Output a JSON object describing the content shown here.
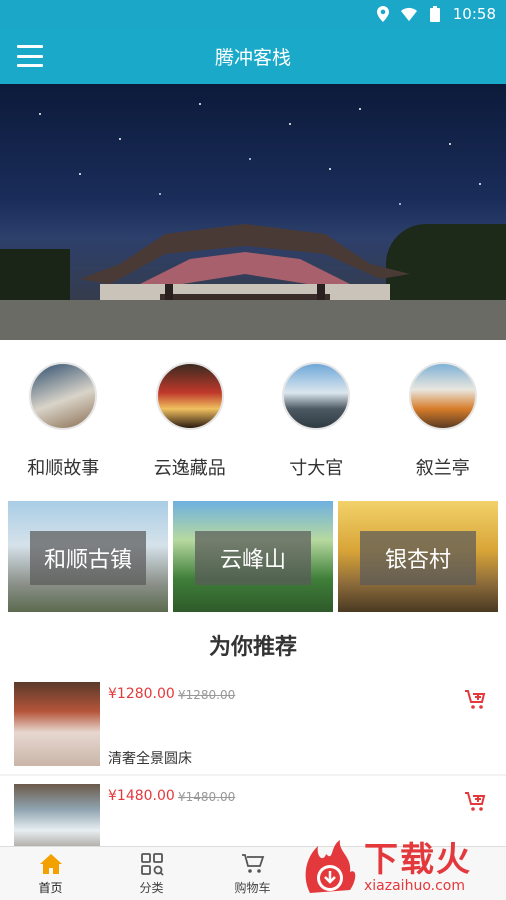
{
  "status_bar": {
    "time": "10:58"
  },
  "app_bar": {
    "title": "腾冲客栈"
  },
  "categories": [
    {
      "label": "和顺故事"
    },
    {
      "label": "云逸藏品"
    },
    {
      "label": "寸大官"
    },
    {
      "label": "叙兰亭"
    }
  ],
  "places": [
    {
      "label": "和顺古镇"
    },
    {
      "label": "云峰山"
    },
    {
      "label": "银杏村"
    }
  ],
  "recommend": {
    "title": "为你推荐"
  },
  "products": [
    {
      "price": "¥1280.00",
      "original_price": "¥1280.00",
      "name": "清奢全景圆床"
    },
    {
      "price": "¥1480.00",
      "original_price": "¥1480.00",
      "name": ""
    }
  ],
  "tabs": [
    {
      "label": "首页"
    },
    {
      "label": "分类"
    },
    {
      "label": "购物车"
    }
  ],
  "watermark": {
    "brand": "下载火",
    "url": "xiazaihuo.com"
  },
  "colors": {
    "primary": "#1aa9c9",
    "price": "#e4393c",
    "tab_active": "#f2a100"
  }
}
